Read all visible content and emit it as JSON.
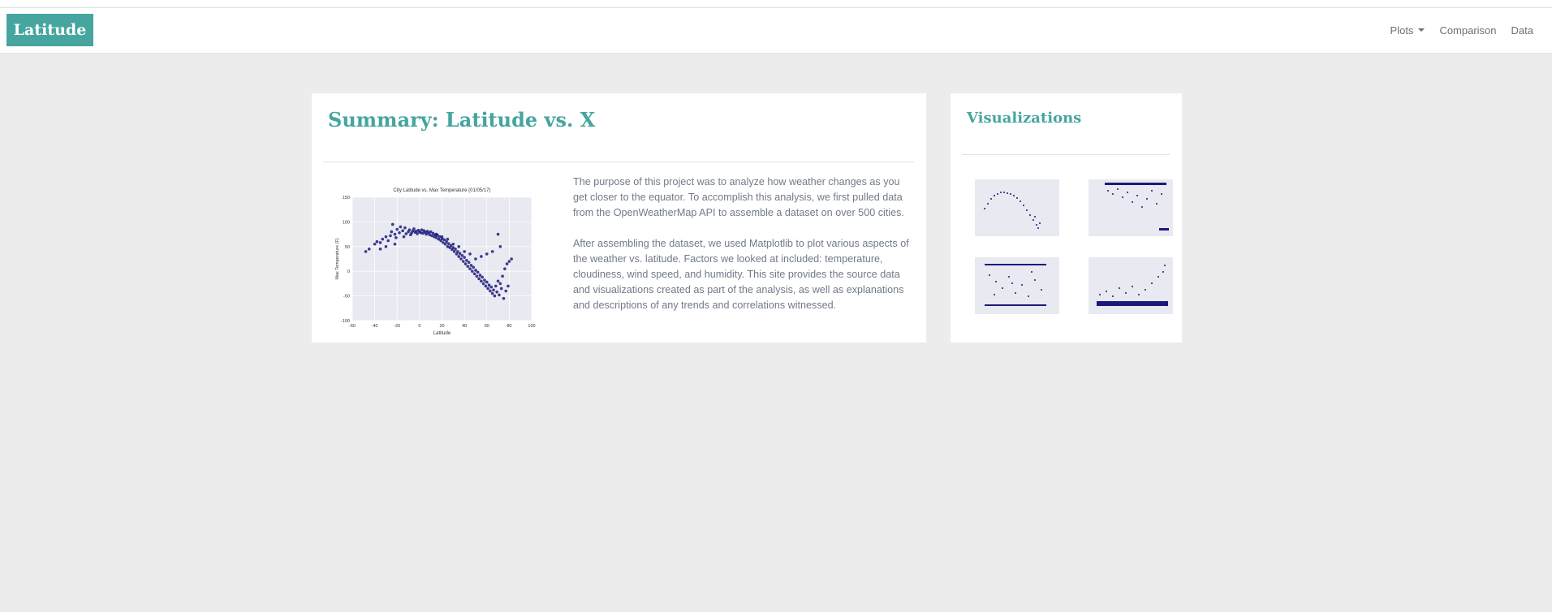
{
  "navbar": {
    "brand": "Latitude",
    "links": [
      {
        "label": "Plots",
        "dropdown": true
      },
      {
        "label": "Comparison"
      },
      {
        "label": "Data"
      }
    ]
  },
  "summary": {
    "title": "Summary: Latitude vs. X",
    "paragraphs": [
      "The purpose of this project was to analyze how weather changes as you get closer to the equator. To accomplish this analysis, we first pulled data from the OpenWeatherMap API to assemble a dataset on over 500 cities.",
      "After assembling the dataset, we used Matplotlib to plot various aspects of the weather vs. latitude. Factors we looked at included: temperature, cloudiness, wind speed, and humidity. This site provides the source data and visualizations created as part of the analysis, as well as explanations and descriptions of any trends and correlations witnessed."
    ],
    "chart": {
      "title": "City Latitude vs. Max Temperature (01/05/17)",
      "xlabel": "Latitude",
      "ylabel": "Max Temperature (F)"
    }
  },
  "visualizations": {
    "title": "Visualizations"
  },
  "colors": {
    "accent": "#46a59f",
    "background": "#ececec",
    "text_muted": "#717a89",
    "point": "#1a1a7a",
    "plot_bg": "#e8e9f1"
  },
  "chart_data": {
    "type": "scatter",
    "title": "City Latitude vs. Max Temperature (01/05/17)",
    "xlabel": "Latitude",
    "ylabel": "Max Temperature (F)",
    "xlim": [
      -60,
      100
    ],
    "ylim": [
      -100,
      150
    ],
    "xticks": [
      -60,
      -40,
      -20,
      0,
      20,
      40,
      60,
      80,
      100
    ],
    "yticks": [
      -100,
      -50,
      0,
      50,
      100,
      150
    ],
    "grid": true,
    "series": [
      {
        "points": [
          [
            -48,
            40
          ],
          [
            -45,
            45
          ],
          [
            -40,
            55
          ],
          [
            -38,
            60
          ],
          [
            -35,
            58
          ],
          [
            -33,
            65
          ],
          [
            -30,
            70
          ],
          [
            -28,
            62
          ],
          [
            -26,
            72
          ],
          [
            -25,
            80
          ],
          [
            -24,
            95
          ],
          [
            -22,
            75
          ],
          [
            -21,
            68
          ],
          [
            -20,
            85
          ],
          [
            -18,
            78
          ],
          [
            -17,
            90
          ],
          [
            -15,
            82
          ],
          [
            -14,
            70
          ],
          [
            -13,
            88
          ],
          [
            -12,
            76
          ],
          [
            -10,
            80
          ],
          [
            -9,
            84
          ],
          [
            -8,
            74
          ],
          [
            -7,
            78
          ],
          [
            -6,
            82
          ],
          [
            -5,
            86
          ],
          [
            -4,
            79
          ],
          [
            -3,
            81
          ],
          [
            -2,
            76
          ],
          [
            -1,
            83
          ],
          [
            0,
            80
          ],
          [
            1,
            78
          ],
          [
            2,
            84
          ],
          [
            3,
            77
          ],
          [
            4,
            82
          ],
          [
            5,
            79
          ],
          [
            6,
            75
          ],
          [
            7,
            81
          ],
          [
            8,
            78
          ],
          [
            9,
            74
          ],
          [
            10,
            80
          ],
          [
            11,
            72
          ],
          [
            12,
            77
          ],
          [
            13,
            70
          ],
          [
            14,
            74
          ],
          [
            15,
            68
          ],
          [
            16,
            73
          ],
          [
            17,
            65
          ],
          [
            18,
            70
          ],
          [
            19,
            62
          ],
          [
            20,
            66
          ],
          [
            21,
            58
          ],
          [
            22,
            64
          ],
          [
            23,
            55
          ],
          [
            24,
            60
          ],
          [
            25,
            50
          ],
          [
            26,
            56
          ],
          [
            27,
            48
          ],
          [
            28,
            52
          ],
          [
            29,
            44
          ],
          [
            30,
            48
          ],
          [
            31,
            40
          ],
          [
            32,
            45
          ],
          [
            33,
            35
          ],
          [
            34,
            40
          ],
          [
            35,
            30
          ],
          [
            36,
            36
          ],
          [
            37,
            25
          ],
          [
            38,
            32
          ],
          [
            39,
            20
          ],
          [
            40,
            28
          ],
          [
            41,
            15
          ],
          [
            42,
            22
          ],
          [
            43,
            10
          ],
          [
            44,
            18
          ],
          [
            45,
            5
          ],
          [
            46,
            12
          ],
          [
            47,
            0
          ],
          [
            48,
            8
          ],
          [
            49,
            -5
          ],
          [
            50,
            2
          ],
          [
            51,
            -10
          ],
          [
            52,
            -2
          ],
          [
            53,
            -15
          ],
          [
            54,
            -8
          ],
          [
            55,
            -20
          ],
          [
            56,
            -12
          ],
          [
            57,
            -25
          ],
          [
            58,
            -18
          ],
          [
            59,
            -30
          ],
          [
            60,
            -22
          ],
          [
            61,
            -35
          ],
          [
            62,
            -28
          ],
          [
            63,
            -40
          ],
          [
            64,
            -32
          ],
          [
            65,
            -45
          ],
          [
            66,
            -38
          ],
          [
            67,
            -50
          ],
          [
            68,
            -30
          ],
          [
            69,
            -42
          ],
          [
            70,
            -20
          ],
          [
            71,
            -48
          ],
          [
            72,
            -25
          ],
          [
            73,
            -35
          ],
          [
            74,
            -10
          ],
          [
            75,
            -55
          ],
          [
            76,
            5
          ],
          [
            77,
            -40
          ],
          [
            78,
            15
          ],
          [
            79,
            -30
          ],
          [
            80,
            20
          ],
          [
            82,
            25
          ],
          [
            70,
            75
          ],
          [
            72,
            50
          ],
          [
            65,
            40
          ],
          [
            60,
            35
          ],
          [
            55,
            30
          ],
          [
            50,
            25
          ],
          [
            45,
            35
          ],
          [
            40,
            40
          ],
          [
            35,
            50
          ],
          [
            30,
            55
          ],
          [
            25,
            65
          ],
          [
            20,
            70
          ],
          [
            15,
            75
          ],
          [
            -35,
            45
          ],
          [
            -30,
            50
          ],
          [
            -22,
            55
          ]
        ]
      }
    ]
  }
}
